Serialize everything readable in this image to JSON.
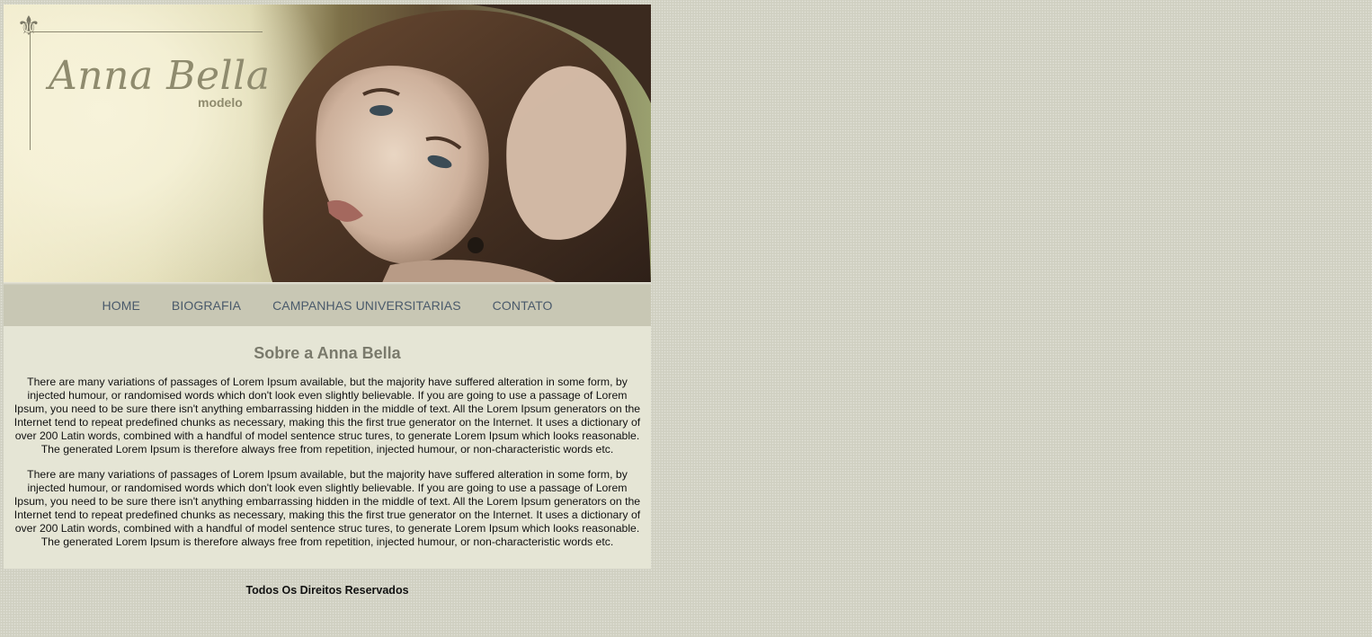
{
  "header": {
    "logo_name": "Anna Bella",
    "logo_subtitle": "modelo",
    "fleur_icon": "fleur-de-lis-icon"
  },
  "nav": {
    "items": [
      "HOME",
      "BIOGRAFIA",
      "CAMPANHAS UNIVERSITARIAS",
      "CONTATO"
    ]
  },
  "main": {
    "title": "Sobre a Anna Bella",
    "paragraphs": [
      "There are many variations of passages of Lorem Ipsum available, but the majority have suffered alteration in some form, by injected humour, or randomised words which don't look even slightly believable. If you are going to use a passage of Lorem Ipsum, you need to be sure there isn't anything embarrassing hidden in the middle of text. All the Lorem Ipsum generators on the Internet tend to repeat predefined chunks as necessary, making this the first true generator on the Internet. It uses a dictionary of over 200 Latin words, combined with a handful of model sentence struc tures, to generate Lorem Ipsum which looks reasonable. The generated Lorem Ipsum is therefore always free from repetition, injected humour, or non-characteristic words etc.",
      "There are many variations of passages of Lorem Ipsum available, but the majority have suffered alteration in some form, by injected humour, or randomised words which don't look even slightly believable. If you are going to use a passage of Lorem Ipsum, you need to be sure there isn't anything embarrassing hidden in the middle of text. All the Lorem Ipsum generators on the Internet tend to repeat predefined chunks as necessary, making this the first true generator on the Internet. It uses a dictionary of over 200 Latin words, combined with a handful of model sentence struc tures, to generate Lorem Ipsum which looks reasonable. The generated Lorem Ipsum is therefore always free from repetition, injected humour, or non-characteristic words etc."
    ]
  },
  "footer": {
    "text": "Todos Os Direitos Reservados"
  },
  "colors": {
    "page_background": "#d3d3c5",
    "nav_background": "#c8c7b4",
    "nav_link": "#4a5a6b",
    "content_background": "#e5e5d5",
    "title": "#7a7a6c"
  }
}
